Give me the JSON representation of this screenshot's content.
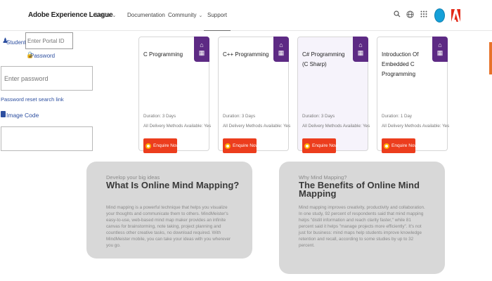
{
  "nav": {
    "brand": "Adobe Experience League",
    "links": [
      {
        "label": "Learn",
        "has_menu": true
      },
      {
        "label": "Documentation",
        "has_menu": false
      },
      {
        "label": "Community",
        "has_menu": true
      },
      {
        "label": "Support",
        "has_menu": false,
        "active": true
      }
    ],
    "icons": [
      "search-icon",
      "globe-icon",
      "apps-grid-icon",
      "avatar",
      "adobe-logo"
    ],
    "accent_color": "#e8732b",
    "avatar_color": "#15a0d8"
  },
  "login": {
    "student_id_label": "Student ID",
    "student_id_placeholder": "Enter Portal ID",
    "password_label": "Password",
    "password_placeholder": "Enter password",
    "forgot_link": "Password reset search link",
    "image_code_label": "Image Code",
    "label_color": "#2d4fa0"
  },
  "courses": [
    {
      "title": "C Programming",
      "duration": "Duration: 3 Days",
      "delivery": "All Delivery Methods Available: Yes",
      "button": "Enquire Now"
    },
    {
      "title": "C++ Programming",
      "duration": "Duration: 3 Days",
      "delivery": "All Delivery Methods Available: Yes",
      "button": "Enquire Now"
    },
    {
      "title": "C# Programming (C Sharp)",
      "duration": "Duration: 3 Days",
      "delivery": "All Delivery Methods Available: Yes",
      "button": "Enquire Now"
    },
    {
      "title": "Introduction Of Embedded C Programming",
      "duration": "Duration: 1 Day",
      "delivery": "All Delivery Methods Available: Yes",
      "button": "Enquire Now"
    }
  ],
  "course_colors": {
    "badge": "#5d2a84",
    "button": "#ec3d1d"
  },
  "features": [
    {
      "eyebrow": "Develop your big ideas",
      "title": "What Is Online Mind Mapping?",
      "body": "Mind mapping is a powerful technique that helps you visualize your thoughts and communicate them to others. MindMeister's easy-to-use, web-based mind map maker provides an infinite canvas for brainstorming, note taking, project planning and countless other creative tasks, no download required. With MindMeister mobile, you can take your ideas with you wherever you go."
    },
    {
      "eyebrow": "Why Mind Mapping?",
      "title": "The Benefits of Online Mind Mapping",
      "body": "Mind mapping improves creativity, productivity and collaboration. In one study, 92 percent of respondents said that mind mapping helps \"distill information and reach clarity faster,\" while 81 percent said it helps \"manage projects more efficiently\". It's not just for business: mind maps help students improve knowledge retention and recall, according to some studies by up to 32 percent."
    }
  ]
}
